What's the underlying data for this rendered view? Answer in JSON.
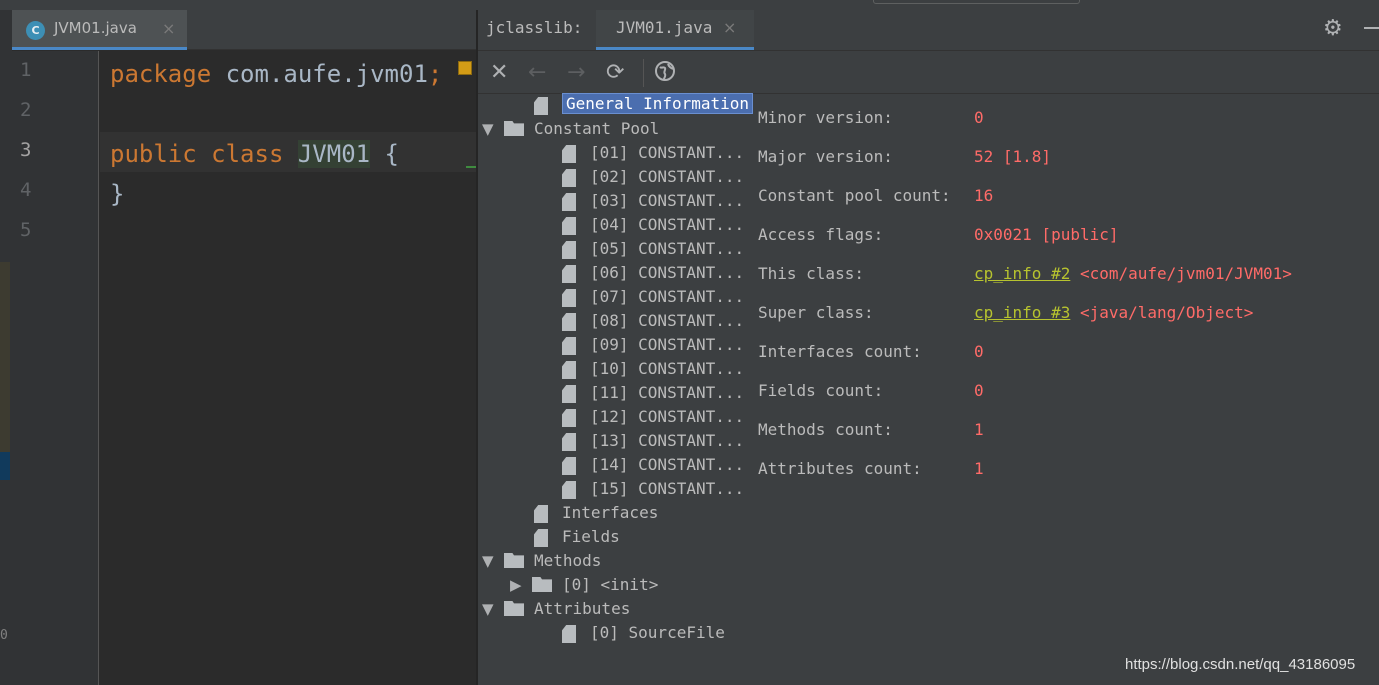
{
  "editor": {
    "tab": {
      "label": "JVM01.java",
      "icon_letter": "C",
      "close": "×"
    },
    "lines": [
      {
        "num": "1",
        "parts": [
          {
            "t": "package",
            "k": "kw"
          },
          {
            "t": " com.aufe.jvm01",
            "k": ""
          },
          {
            "t": ";",
            "k": "kw"
          }
        ]
      },
      {
        "num": "2",
        "parts": []
      },
      {
        "num": "3",
        "parts": [
          {
            "t": "public",
            "k": "kw"
          },
          {
            "t": " ",
            "k": ""
          },
          {
            "t": "class",
            "k": "kw"
          },
          {
            "t": " ",
            "k": ""
          },
          {
            "t": "JVM01",
            "k": "cls"
          },
          {
            "t": " {",
            "k": ""
          }
        ]
      },
      {
        "num": "4",
        "parts": [
          {
            "t": "}",
            "k": ""
          }
        ]
      },
      {
        "num": "5",
        "parts": []
      }
    ],
    "active_line": "3"
  },
  "left_strip": {
    "zero": "0"
  },
  "jclasslib": {
    "title": "jclasslib:",
    "tab": {
      "label": "JVM01.java",
      "close": "×"
    },
    "toolbar": {
      "close": "✕",
      "back": "←",
      "forward": "→",
      "refresh": "⟳",
      "web": "🌐"
    },
    "tree": [
      {
        "label": "General Information",
        "icon": "file",
        "indent": 1,
        "arrow": "",
        "selected": true
      },
      {
        "label": "Constant Pool",
        "icon": "folder",
        "indent": 0,
        "arrow": "▼"
      },
      {
        "label": "[01] CONSTANT...",
        "icon": "file",
        "indent": 2,
        "arrow": ""
      },
      {
        "label": "[02] CONSTANT...",
        "icon": "file",
        "indent": 2,
        "arrow": ""
      },
      {
        "label": "[03] CONSTANT...",
        "icon": "file",
        "indent": 2,
        "arrow": ""
      },
      {
        "label": "[04] CONSTANT...",
        "icon": "file",
        "indent": 2,
        "arrow": ""
      },
      {
        "label": "[05] CONSTANT...",
        "icon": "file",
        "indent": 2,
        "arrow": ""
      },
      {
        "label": "[06] CONSTANT...",
        "icon": "file",
        "indent": 2,
        "arrow": ""
      },
      {
        "label": "[07] CONSTANT...",
        "icon": "file",
        "indent": 2,
        "arrow": ""
      },
      {
        "label": "[08] CONSTANT...",
        "icon": "file",
        "indent": 2,
        "arrow": ""
      },
      {
        "label": "[09] CONSTANT...",
        "icon": "file",
        "indent": 2,
        "arrow": ""
      },
      {
        "label": "[10] CONSTANT...",
        "icon": "file",
        "indent": 2,
        "arrow": ""
      },
      {
        "label": "[11] CONSTANT...",
        "icon": "file",
        "indent": 2,
        "arrow": ""
      },
      {
        "label": "[12] CONSTANT...",
        "icon": "file",
        "indent": 2,
        "arrow": ""
      },
      {
        "label": "[13] CONSTANT...",
        "icon": "file",
        "indent": 2,
        "arrow": ""
      },
      {
        "label": "[14] CONSTANT...",
        "icon": "file",
        "indent": 2,
        "arrow": ""
      },
      {
        "label": "[15] CONSTANT...",
        "icon": "file",
        "indent": 2,
        "arrow": ""
      },
      {
        "label": "Interfaces",
        "icon": "file",
        "indent": 1,
        "arrow": ""
      },
      {
        "label": "Fields",
        "icon": "file",
        "indent": 1,
        "arrow": ""
      },
      {
        "label": "Methods",
        "icon": "folder",
        "indent": 0,
        "arrow": "▼"
      },
      {
        "label": "[0] <init>",
        "icon": "folder",
        "indent": 1,
        "arrow": "▶"
      },
      {
        "label": "Attributes",
        "icon": "folder",
        "indent": 0,
        "arrow": "▼"
      },
      {
        "label": "[0] SourceFile",
        "icon": "file",
        "indent": 2,
        "arrow": ""
      }
    ],
    "info": [
      {
        "label": "Minor version:",
        "value": "0"
      },
      {
        "label": "Major version:",
        "value": "52 [1.8]"
      },
      {
        "label": "Constant pool count:",
        "value": "16"
      },
      {
        "label": "Access flags:",
        "value": "0x0021 [public]"
      },
      {
        "label": "This class:",
        "link": "cp_info #2",
        "value": "<com/aufe/jvm01/JVM01>"
      },
      {
        "label": "Super class:",
        "link": "cp_info #3",
        "value": "<java/lang/Object>"
      },
      {
        "label": "Interfaces count:",
        "value": "0"
      },
      {
        "label": "Fields count:",
        "value": "0"
      },
      {
        "label": "Methods count:",
        "value": "1"
      },
      {
        "label": "Attributes count:",
        "value": "1"
      }
    ]
  },
  "watermark": "https://blog.csdn.net/qq_43186095",
  "colors": {
    "keyword": "#cc7832",
    "value_red": "#ff6b68",
    "link_green": "#b7c32f",
    "selection": "#4b6eaf",
    "tab_underline": "#4a88c7"
  }
}
